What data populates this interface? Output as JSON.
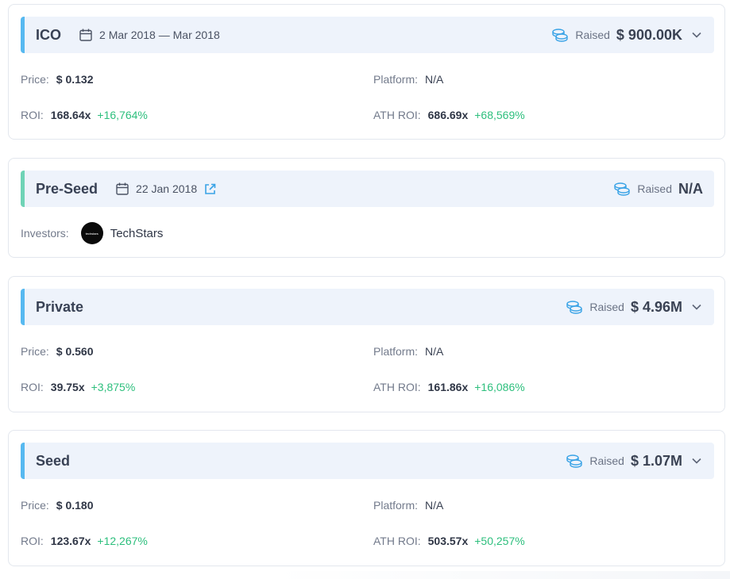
{
  "rounds": [
    {
      "name": "ICO",
      "date": "2 Mar 2018 — Mar 2018",
      "raised_label": "Raised",
      "raised_value": "$ 900.00K",
      "price_label": "Price:",
      "price": "$ 0.132",
      "platform_label": "Platform:",
      "platform": "N/A",
      "roi_label": "ROI:",
      "roi": "168.64x",
      "roi_pct": "+16,764%",
      "ath_label": "ATH ROI:",
      "ath": "686.69x",
      "ath_pct": "+68,569%"
    },
    {
      "name": "Pre-Seed",
      "date": "22 Jan 2018",
      "raised_label": "Raised",
      "raised_value": "N/A",
      "investors_label": "Investors:",
      "investor_logo_text": "techstars",
      "investor_name": "TechStars"
    },
    {
      "name": "Private",
      "raised_label": "Raised",
      "raised_value": "$ 4.96M",
      "price_label": "Price:",
      "price": "$ 0.560",
      "platform_label": "Platform:",
      "platform": "N/A",
      "roi_label": "ROI:",
      "roi": "39.75x",
      "roi_pct": "+3,875%",
      "ath_label": "ATH ROI:",
      "ath": "161.86x",
      "ath_pct": "+16,086%"
    },
    {
      "name": "Seed",
      "raised_label": "Raised",
      "raised_value": "$ 1.07M",
      "price_label": "Price:",
      "price": "$ 0.180",
      "platform_label": "Platform:",
      "platform": "N/A",
      "roi_label": "ROI:",
      "roi": "123.67x",
      "roi_pct": "+12,267%",
      "ath_label": "ATH ROI:",
      "ath": "503.57x",
      "ath_pct": "+50,257%"
    }
  ],
  "icons": {
    "calendar": "calendar-icon",
    "coins": "coins-icon",
    "chevron": "chevron-down-icon",
    "external": "external-link-icon"
  },
  "colors": {
    "accent_blue": "#57b9f0",
    "accent_green": "#6fd3b6",
    "positive": "#2dbf7d",
    "bar_bg": "#eef3fb"
  }
}
